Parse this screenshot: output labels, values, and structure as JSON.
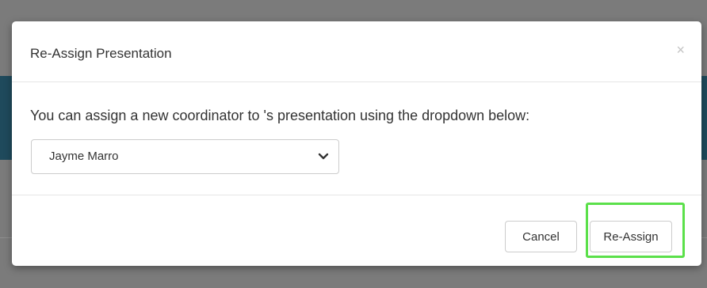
{
  "modal": {
    "title": "Re-Assign Presentation",
    "close_symbol": "×",
    "body_text": "You can assign a new coordinator to 's presentation using the dropdown below:",
    "coordinator_select": {
      "selected": "Jayme Marro"
    },
    "buttons": {
      "cancel_label": "Cancel",
      "reassign_label": "Re-Assign"
    }
  },
  "colors": {
    "highlight": "#5be04a",
    "backdrop": "#7b7b7b",
    "background_band": "#1f4a5c"
  },
  "icons": {
    "close": "close-icon",
    "dropdown": "chevron-down-icon"
  }
}
